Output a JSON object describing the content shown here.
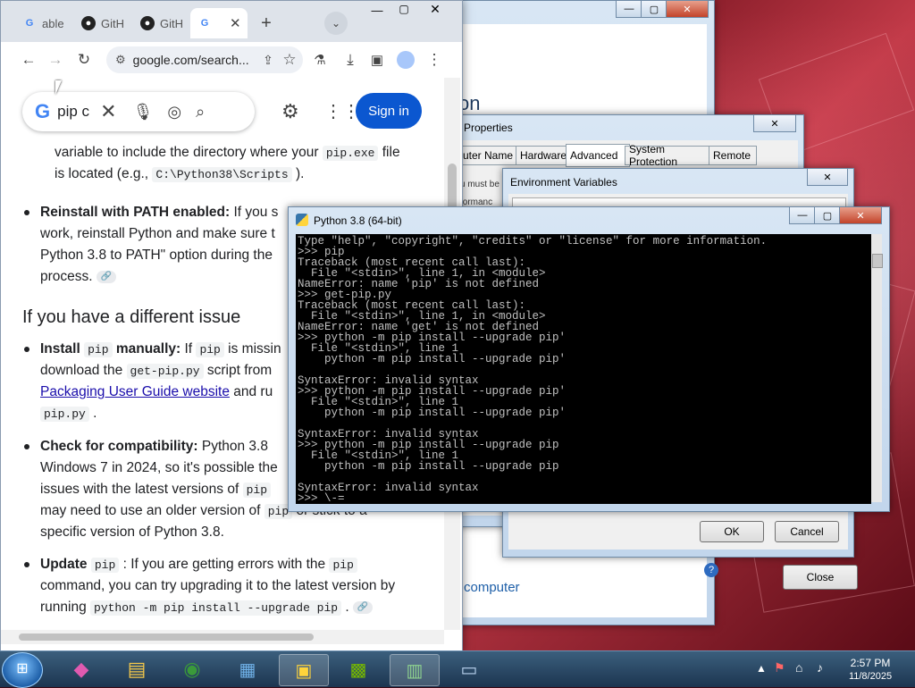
{
  "browser": {
    "tabs": [
      {
        "label": "able",
        "icon": "google-icon"
      },
      {
        "label": "GitH",
        "icon": "github-icon"
      },
      {
        "label": "GitH",
        "icon": "github-icon"
      },
      {
        "label": "G",
        "icon": "google-icon"
      }
    ],
    "new_tab": "+",
    "url": "google.com/search...",
    "search_query": "pip c",
    "sign_in": "Sign in",
    "content": {
      "p1": "variable to include the directory where your",
      "p1_code": "pip.exe",
      "p1_tail": "file",
      "p1b": "is located (e.g.,",
      "p1b_code": "C:\\Python38\\Scripts",
      "p1b_tail": ").",
      "b1_bold": "Reinstall with PATH enabled:",
      "b1_text1": "If you s",
      "b1_text2": "work, reinstall Python and make sure t",
      "b1_text3": "Python 3.8 to PATH\" option during the",
      "b1_text4": "process.",
      "heading": "If you have a different issue",
      "b2_bold": "Install",
      "b2_code": "pip",
      "b2_bold2": "manually:",
      "b2_text1": "If",
      "b2_code2": "pip",
      "b2_text1b": "is missin",
      "b2_text2": "download the",
      "b2_code3": "get-pip.py",
      "b2_text2b": "script from",
      "b2_link": "Packaging User Guide website",
      "b2_text3": "and ru",
      "b2_code4": "pip.py",
      "b2_text4": ".",
      "b3_bold": "Check for compatibility:",
      "b3_text1": "Python 3.8",
      "b3_text2": "Windows 7 in 2024, so it's possible the",
      "b3_text3": "issues with the latest versions of",
      "b3_code": "pip",
      "b3_text4": "may need to use an older version of",
      "b3_code2": "pip",
      "b3_text4b": "or stick to a",
      "b3_text5": "specific version of Python 3.8.",
      "b4_bold": "Update",
      "b4_code": "pip",
      "b4_text1": ": If you are getting errors with the",
      "b4_code2": "pip",
      "b4_text2": "command, you can try upgrading it to the latest version by",
      "b4_text3": "running",
      "b4_code3": "python -m pip install --upgrade pip",
      "b4_text3b": "."
    }
  },
  "system_window": {
    "title_fragment": "on",
    "footer_link": "computer",
    "close_button": "Close"
  },
  "system_properties": {
    "title": "Properties",
    "tabs": [
      "uter Name",
      "Hardware",
      "Advanced",
      "System Protection",
      "Remote"
    ],
    "active_tab": "Advanced",
    "fragment1": "u must be",
    "fragment2": "formanc"
  },
  "env_vars": {
    "title": "Environment Variables",
    "ok": "OK",
    "cancel": "Cancel"
  },
  "python_console": {
    "title": "Python 3.8 (64-bit)",
    "lines": [
      "Type \"help\", \"copyright\", \"credits\" or \"license\" for more information.",
      ">>> pip",
      "Traceback (most recent call last):",
      "  File \"<stdin>\", line 1, in <module>",
      "NameError: name 'pip' is not defined",
      ">>> get-pip.py",
      "Traceback (most recent call last):",
      "  File \"<stdin>\", line 1, in <module>",
      "NameError: name 'get' is not defined",
      ">>> python -m pip install --upgrade pip'",
      "  File \"<stdin>\", line 1",
      "    python -m pip install --upgrade pip'",
      "",
      "SyntaxError: invalid syntax",
      ">>> python -m pip install --upgrade pip'",
      "  File \"<stdin>\", line 1",
      "    python -m pip install --upgrade pip'",
      "",
      "SyntaxError: invalid syntax",
      ">>> python -m pip install --upgrade pip",
      "  File \"<stdin>\", line 1",
      "    python -m pip install --upgrade pip",
      "",
      "SyntaxError: invalid syntax",
      ">>> \\-="
    ]
  },
  "taskbar": {
    "time": "2:57 PM",
    "date": "11/8/2025"
  }
}
